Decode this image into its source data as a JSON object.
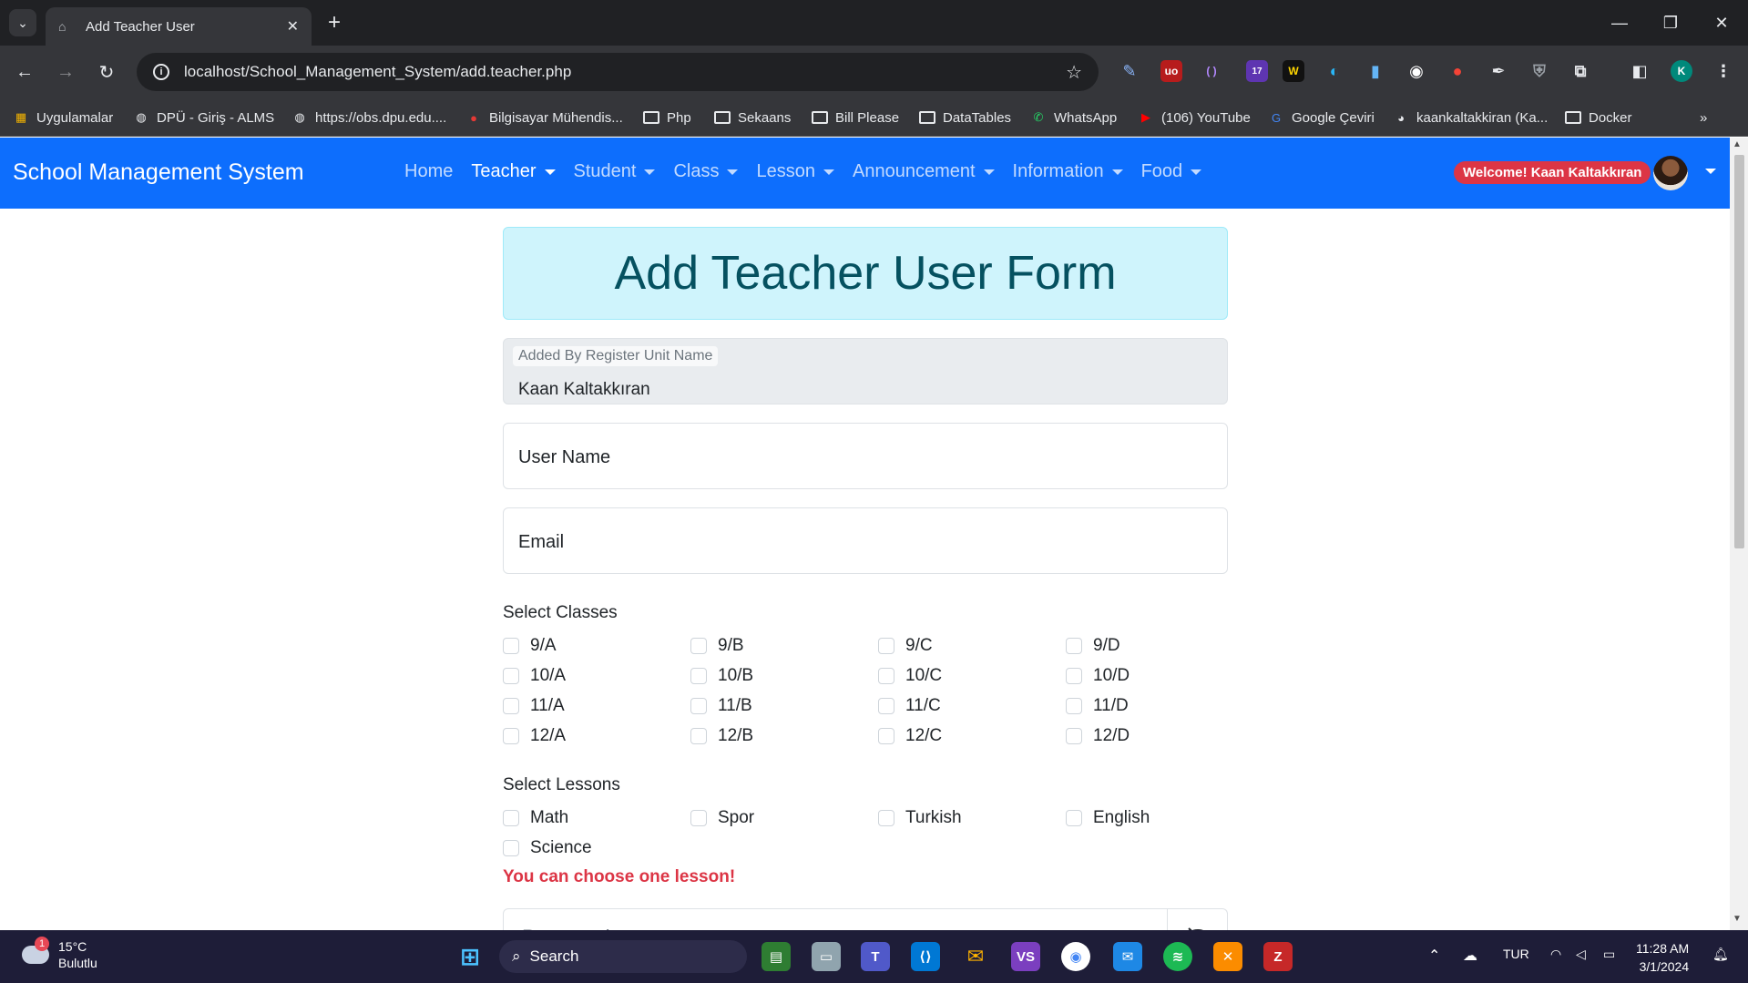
{
  "browser": {
    "tab_title": "Add Teacher User",
    "url": "localhost/School_Management_System/add.teacher.php",
    "bookmarks": [
      {
        "label": "Uygulamalar",
        "icon": "apps-grid-icon"
      },
      {
        "label": "DPÜ - Giriş - ALMS",
        "icon": "globe-icon"
      },
      {
        "label": "https://obs.dpu.edu....",
        "icon": "globe-icon"
      },
      {
        "label": "Bilgisayar Mühendis...",
        "icon": "site-icon"
      },
      {
        "label": "Php",
        "icon": "folder-icon"
      },
      {
        "label": "Sekaans",
        "icon": "folder-icon"
      },
      {
        "label": "Bill Please",
        "icon": "folder-icon"
      },
      {
        "label": "DataTables",
        "icon": "folder-icon"
      },
      {
        "label": "WhatsApp",
        "icon": "whatsapp-icon"
      },
      {
        "label": "(106) YouTube",
        "icon": "youtube-icon"
      },
      {
        "label": "Google Çeviri",
        "icon": "google-translate-icon"
      },
      {
        "label": "kaankaltakkiran (Ka...",
        "icon": "github-icon"
      },
      {
        "label": "Docker",
        "icon": "folder-icon"
      }
    ],
    "ext_badge": "17",
    "profile_initial": "K"
  },
  "navbar": {
    "brand": "School Management System",
    "links": [
      {
        "label": "Home",
        "dropdown": false,
        "active": false
      },
      {
        "label": "Teacher",
        "dropdown": true,
        "active": true
      },
      {
        "label": "Student",
        "dropdown": true,
        "active": false
      },
      {
        "label": "Class",
        "dropdown": true,
        "active": false
      },
      {
        "label": "Lesson",
        "dropdown": true,
        "active": false
      },
      {
        "label": "Announcement",
        "dropdown": true,
        "active": false
      },
      {
        "label": "Information",
        "dropdown": true,
        "active": false
      },
      {
        "label": "Food",
        "dropdown": true,
        "active": false
      }
    ],
    "welcome": "Welcome! Kaan Kaltakkıran"
  },
  "form": {
    "title": "Add Teacher User Form",
    "added_by_label": "Added By Register Unit Name",
    "added_by_value": "Kaan Kaltakkıran",
    "username_placeholder": "User Name",
    "email_placeholder": "Email",
    "classes_label": "Select Classes",
    "classes": [
      "9/A",
      "9/B",
      "9/C",
      "9/D",
      "10/A",
      "10/B",
      "10/C",
      "10/D",
      "11/A",
      "11/B",
      "11/C",
      "11/D",
      "12/A",
      "12/B",
      "12/C",
      "12/D"
    ],
    "lessons_label": "Select Lessons",
    "lessons": [
      "Math",
      "Spor",
      "Turkish",
      "English",
      "Science"
    ],
    "lesson_warning": "You can choose one lesson!",
    "password_placeholder": "Password"
  },
  "taskbar": {
    "temperature": "15°C",
    "weather": "Bulutlu",
    "weather_badge": "1",
    "search": "Search",
    "language": "TUR",
    "time": "11:28 AM",
    "date": "3/1/2024"
  },
  "colors": {
    "navbar": "#0d6efd",
    "alert_bg": "#cff4fc",
    "alert_text": "#055160",
    "danger": "#dc3545"
  }
}
